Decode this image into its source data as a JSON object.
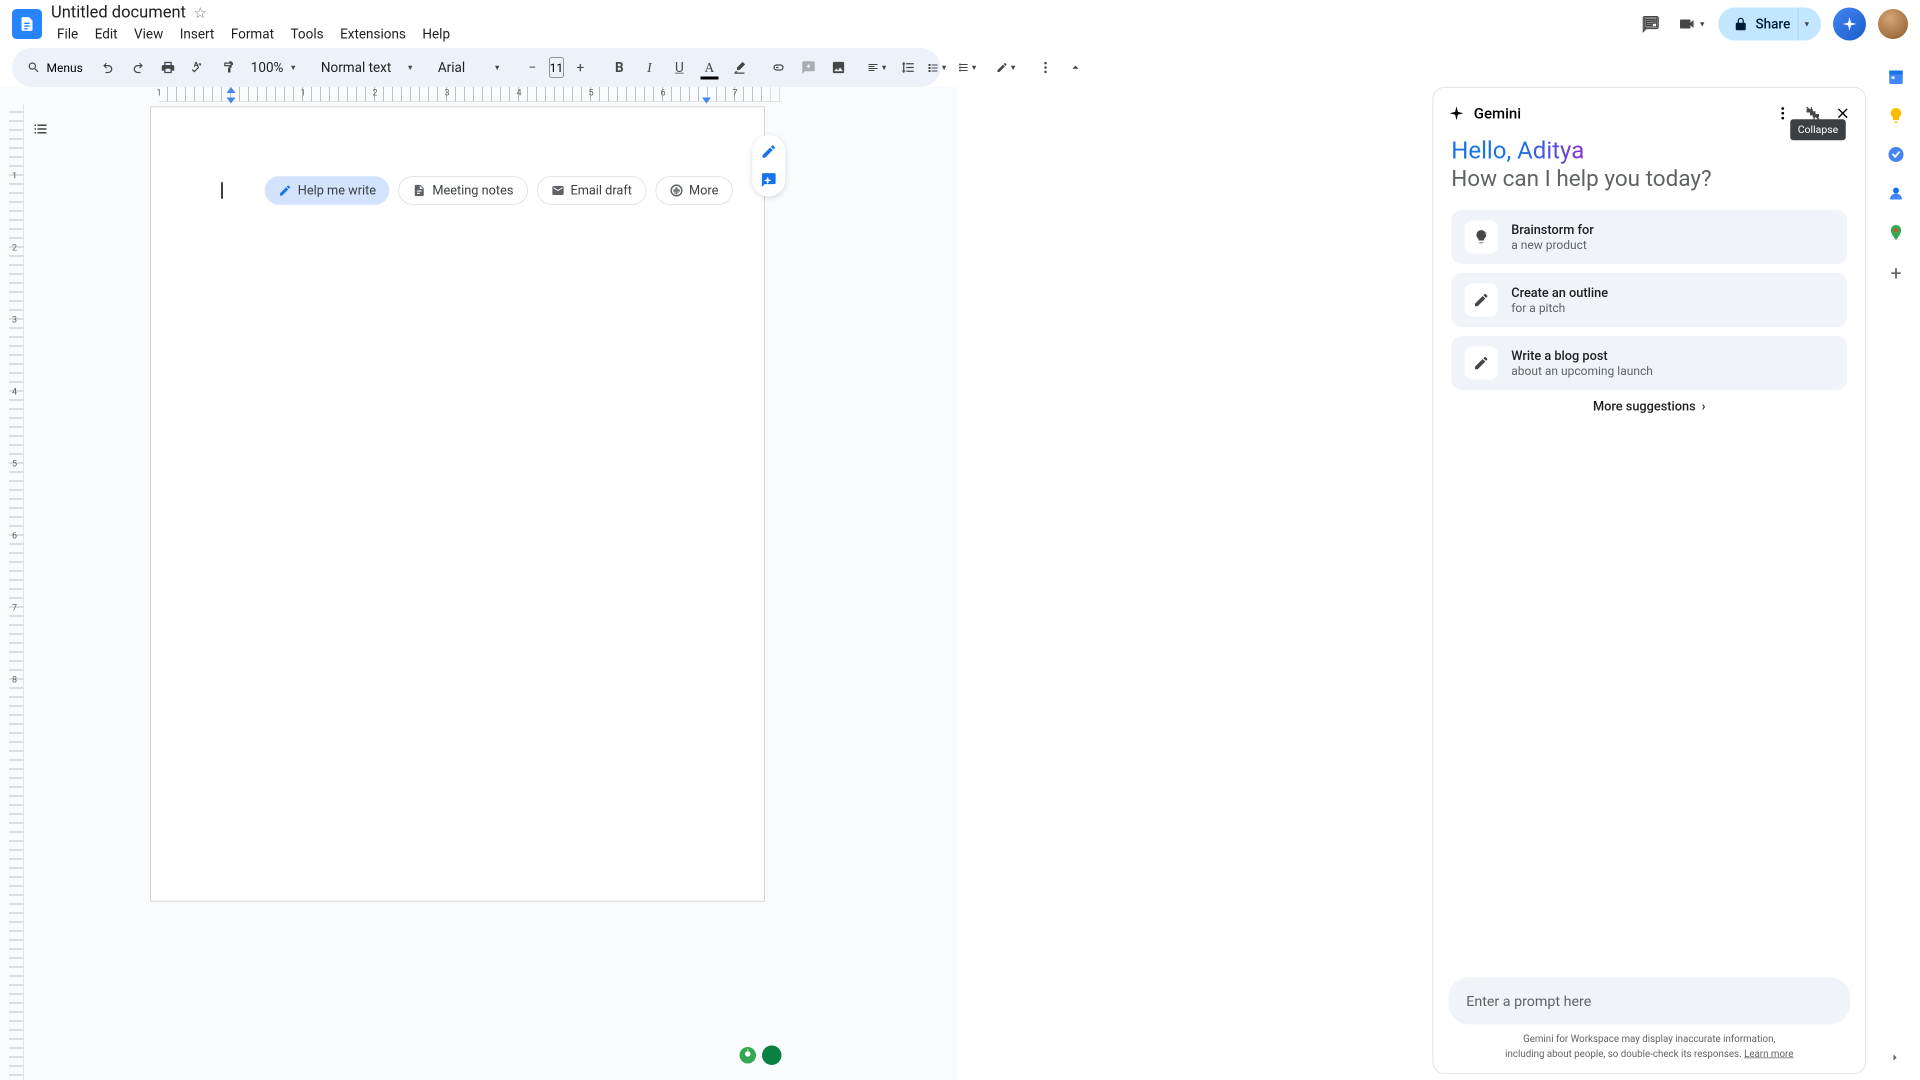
{
  "doc": {
    "title": "Untitled document"
  },
  "menubar": {
    "file": "File",
    "edit": "Edit",
    "view": "View",
    "insert": "Insert",
    "format": "Format",
    "tools": "Tools",
    "extensions": "Extensions",
    "help": "Help"
  },
  "toolbar": {
    "menus": "Menus",
    "zoom": "100%",
    "style": "Normal text",
    "font": "Arial",
    "fontsize": "11"
  },
  "share": {
    "label": "Share"
  },
  "chips": {
    "help": "Help me write",
    "meeting": "Meeting notes",
    "email": "Email draft",
    "more": "More"
  },
  "ruler": {
    "h": [
      "1",
      "1",
      "2",
      "3",
      "4",
      "5",
      "6",
      "7"
    ],
    "v": [
      "1",
      "2",
      "3",
      "4",
      "5",
      "6",
      "7",
      "8"
    ]
  },
  "gemini": {
    "title": "Gemini",
    "tooltip": "Collapse",
    "hello": "Hello,",
    "name": "Aditya",
    "sub": "How can I help you today?",
    "suggestions": [
      {
        "t1": "Brainstorm for",
        "t2": "a new product"
      },
      {
        "t1": "Create an outline",
        "t2": "for a pitch"
      },
      {
        "t1": "Write a blog post",
        "t2": "about an upcoming launch"
      }
    ],
    "more": "More suggestions",
    "prompt_placeholder": "Enter a prompt here",
    "disclaimer_l1": "Gemini for Workspace may display inaccurate information,",
    "disclaimer_l2": "including about people, so double-check its responses. ",
    "learn": "Learn more"
  }
}
